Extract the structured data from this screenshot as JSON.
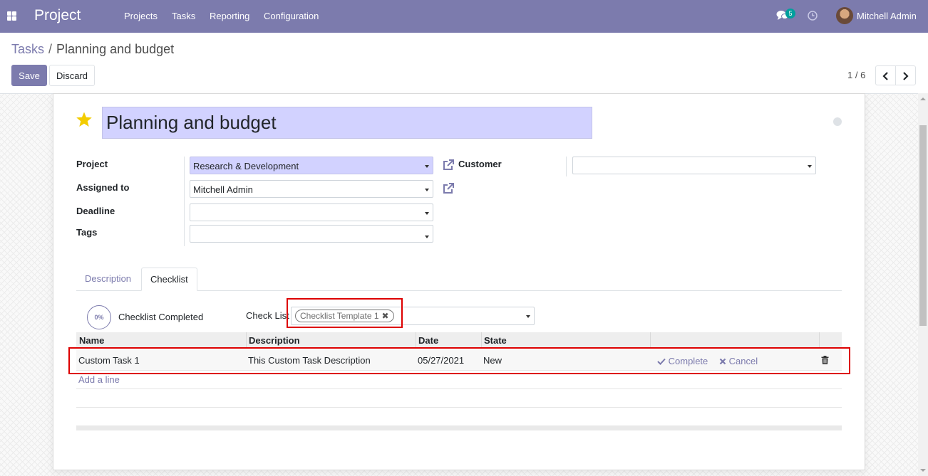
{
  "navbar": {
    "app_name": "Project",
    "menu": [
      "Projects",
      "Tasks",
      "Reporting",
      "Configuration"
    ],
    "message_count": "5",
    "user_name": "Mitchell Admin",
    "color": "#7c7bad"
  },
  "breadcrumb": {
    "parent": "Tasks",
    "separator": "/",
    "current": "Planning and budget"
  },
  "buttons": {
    "save": "Save",
    "discard": "Discard"
  },
  "pager": {
    "value": "1 / 6"
  },
  "form": {
    "title": "Planning and budget",
    "fields": {
      "project": {
        "label": "Project",
        "value": "Research & Development"
      },
      "customer": {
        "label": "Customer",
        "value": ""
      },
      "assigned_to": {
        "label": "Assigned to",
        "value": "Mitchell Admin"
      },
      "deadline": {
        "label": "Deadline",
        "value": ""
      },
      "tags": {
        "label": "Tags",
        "value": ""
      }
    }
  },
  "notebook": {
    "tabs": [
      "Description",
      "Checklist"
    ],
    "active_tab": "Checklist"
  },
  "checklist": {
    "progress": "0%",
    "completed_label": "Checklist Completed",
    "check_list_label": "Check List",
    "template_tag": "Checklist Template 1",
    "columns": [
      "Name",
      "Description",
      "Date",
      "State"
    ],
    "rows": [
      {
        "name": "Custom Task 1",
        "description": "This Custom Task Description",
        "date": "05/27/2021",
        "state": "New",
        "complete_action": "Complete",
        "cancel_action": "Cancel"
      }
    ],
    "add_line": "Add a line"
  }
}
